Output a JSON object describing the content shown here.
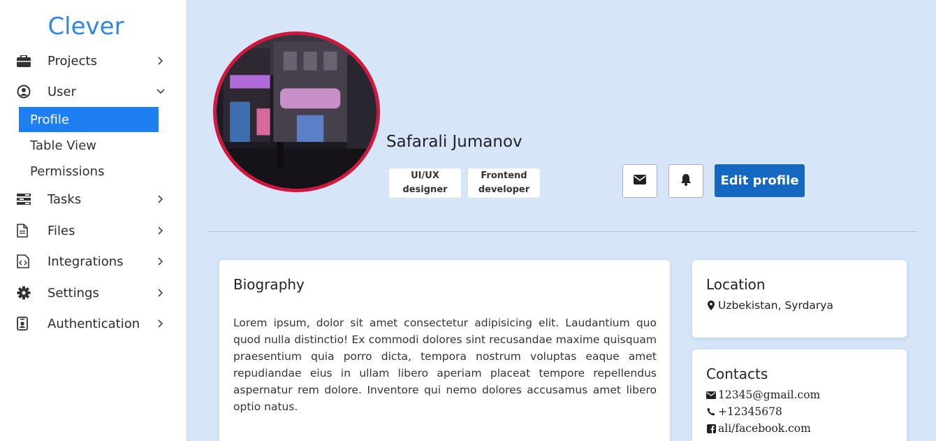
{
  "brand": "Clever",
  "sidebar": {
    "items": [
      {
        "label": "Projects",
        "icon": "briefcase-icon",
        "chevron": "chevron-right-icon"
      },
      {
        "label": "User",
        "icon": "user-circle-icon",
        "chevron": "chevron-down-icon"
      },
      {
        "label": "Tasks",
        "icon": "tasks-icon",
        "chevron": "chevron-right-icon"
      },
      {
        "label": "Files",
        "icon": "file-icon",
        "chevron": "chevron-right-icon"
      },
      {
        "label": "Integrations",
        "icon": "code-file-icon",
        "chevron": "chevron-right-icon"
      },
      {
        "label": "Settings",
        "icon": "gear-icon",
        "chevron": "chevron-right-icon"
      },
      {
        "label": "Authentication",
        "icon": "id-badge-icon",
        "chevron": "chevron-right-icon"
      }
    ],
    "user_subitems": [
      {
        "label": "Profile",
        "active": true
      },
      {
        "label": "Table View",
        "active": false
      },
      {
        "label": "Permissions",
        "active": false
      }
    ]
  },
  "profile": {
    "name": "Safarali Jumanov",
    "tags": [
      {
        "line1": "UI/UX",
        "line2": "designer"
      },
      {
        "line1": "Frontend",
        "line2": "developer"
      }
    ],
    "edit_label": "Edit profile"
  },
  "biography": {
    "title": "Biography",
    "text": "Lorem ipsum, dolor sit amet consectetur adipisicing elit. Laudantium quo quod nulla distinctio! Ex commodi dolores sint recusandae maxime quisquam praesentium quia porro dicta, tempora nostrum voluptas eaque amet repudiandae eius in ullam libero aperiam placeat tempore repellendus aspernatur rem dolore. Inventore qui nemo dolores accusamus amet libero optio natus."
  },
  "location": {
    "title": "Location",
    "value": "Uzbekistan, Syrdarya"
  },
  "contacts": {
    "title": "Contacts",
    "email": "12345@gmail.com",
    "phone": "+12345678",
    "facebook": "ali/facebook.com"
  },
  "colors": {
    "accent": "#1d7ff1",
    "brand": "#2f86e8",
    "avatar_border": "#d2173e",
    "edit_button": "#1468c0",
    "background": "#d6e6f8"
  }
}
